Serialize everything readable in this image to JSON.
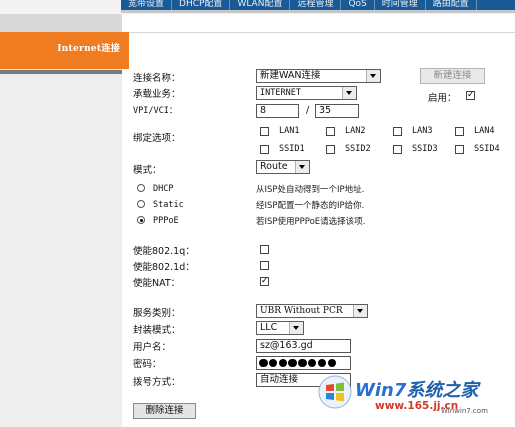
{
  "nav": {
    "tabs": [
      "宽带设置",
      "DHCP配置",
      "WLAN配置",
      "远程管理",
      "QoS",
      "时间管理",
      "路由配置"
    ]
  },
  "sidebar": {
    "active_item": "Internet连接"
  },
  "form": {
    "connection_name": {
      "label": "连接名称：",
      "value": "新建WAN连接"
    },
    "new_button": "新建连接",
    "service": {
      "label": "承载业务：",
      "value": "INTERNET"
    },
    "enable_label": "启用：",
    "enable_checked": true,
    "vpi_vci": {
      "label": "VPI/VCI：",
      "vpi": "8",
      "sep": "/",
      "vci": "35"
    },
    "bind": {
      "label": "绑定选项：",
      "options": [
        {
          "label": "LAN1",
          "checked": false
        },
        {
          "label": "LAN2",
          "checked": false
        },
        {
          "label": "LAN3",
          "checked": false
        },
        {
          "label": "LAN4",
          "checked": false
        },
        {
          "label": "SSID1",
          "checked": false
        },
        {
          "label": "SSID2",
          "checked": false
        },
        {
          "label": "SSID3",
          "checked": false
        },
        {
          "label": "SSID4",
          "checked": false
        }
      ]
    },
    "mode": {
      "label": "模式：",
      "value": "Route"
    },
    "modes": [
      {
        "label": "DHCP",
        "desc": "从ISP处自动得到一个IP地址.",
        "selected": false
      },
      {
        "label": "Static",
        "desc": "经ISP配置一个静态的IP给你.",
        "selected": false
      },
      {
        "label": "PPPoE",
        "desc": "若ISP使用PPPoE请选择该项.",
        "selected": true
      }
    ],
    "enable_8021q": {
      "label": "使能802.1q：",
      "checked": false
    },
    "enable_8021d": {
      "label": "使能802.1d：",
      "checked": false
    },
    "enable_nat": {
      "label": "使能NAT：",
      "checked": true
    },
    "service_class": {
      "label": "服务类别：",
      "value": "UBR Without PCR"
    },
    "encap": {
      "label": "封装模式：",
      "value": "LLC"
    },
    "username": {
      "label": "用户名：",
      "value": "sz@163.gd"
    },
    "password": {
      "label": "密码：",
      "mask_length": 8
    },
    "dial": {
      "label": "拨号方式：",
      "value": "自动连接"
    },
    "delete_button": "删除连接"
  },
  "watermark": {
    "title_a": "Win7",
    "title_b": "系统之家",
    "url": "www.165.jj.cn",
    "url2": "Winwin7.com"
  },
  "colors": {
    "nav_bg": "#1a5a96",
    "sidebar_active": "#f07c22",
    "watermark_blue": "#2f73c5",
    "watermark_red": "#d33a2c"
  }
}
